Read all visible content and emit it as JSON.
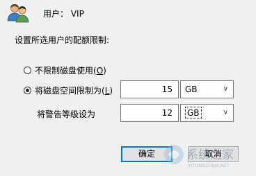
{
  "user": {
    "label": "用户： VIP"
  },
  "prompt": "设置所选用户的配额限制:",
  "options": {
    "no_limit": {
      "text": "不限制磁盘使用(",
      "key": "O",
      "close": ")",
      "checked": false
    },
    "limit": {
      "text": "将磁盘空间限制为(",
      "key": "L",
      "close": ")",
      "checked": true
    }
  },
  "limit": {
    "value": "15",
    "unit": "GB"
  },
  "warning": {
    "label": "将警告等级设为",
    "value": "12",
    "unit": "GB"
  },
  "buttons": {
    "ok": "确定",
    "cancel": "取消"
  },
  "watermark": {
    "text": "系统之家",
    "subtext": "XITONGZHIJIA.NET"
  }
}
